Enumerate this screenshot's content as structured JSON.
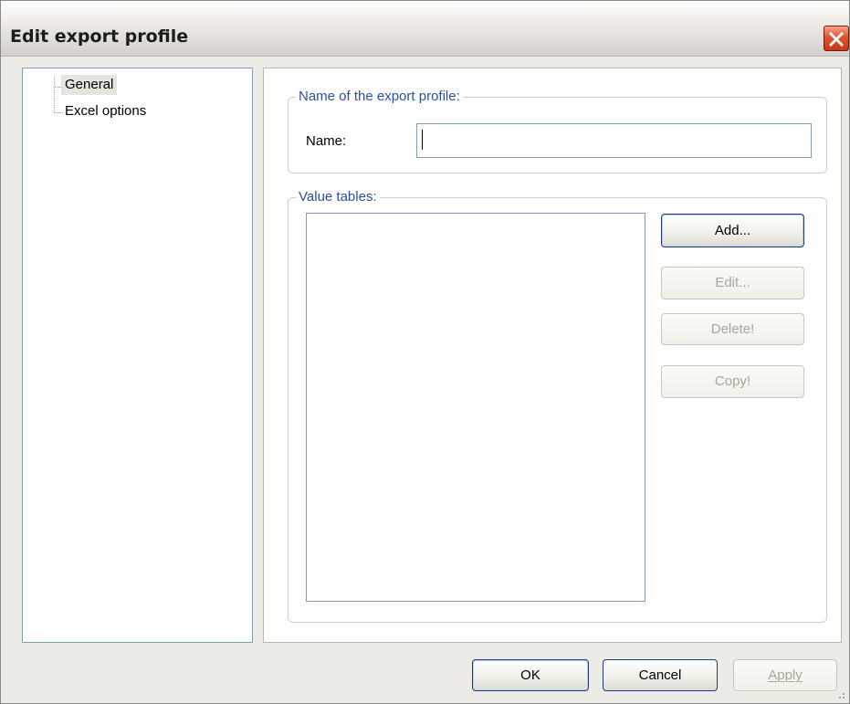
{
  "window": {
    "title": "Edit export profile"
  },
  "tree": {
    "items": [
      {
        "label": "General",
        "selected": true
      },
      {
        "label": "Excel options",
        "selected": false
      }
    ]
  },
  "name_group": {
    "legend": "Name of the export profile:",
    "name_label": "Name:",
    "name_value": ""
  },
  "value_tables_group": {
    "legend": "Value tables:",
    "items": []
  },
  "side_buttons": {
    "add": "Add...",
    "edit": "Edit...",
    "delete": "Delete!",
    "copy": "Copy!"
  },
  "footer": {
    "ok": "OK",
    "cancel": "Cancel",
    "apply": "Apply"
  },
  "colors": {
    "legend_text": "#2e4f9e",
    "close_button": "#e0542f",
    "input_border": "#7f9db9"
  },
  "icons": [
    "close-icon",
    "resize-grip-icon"
  ]
}
